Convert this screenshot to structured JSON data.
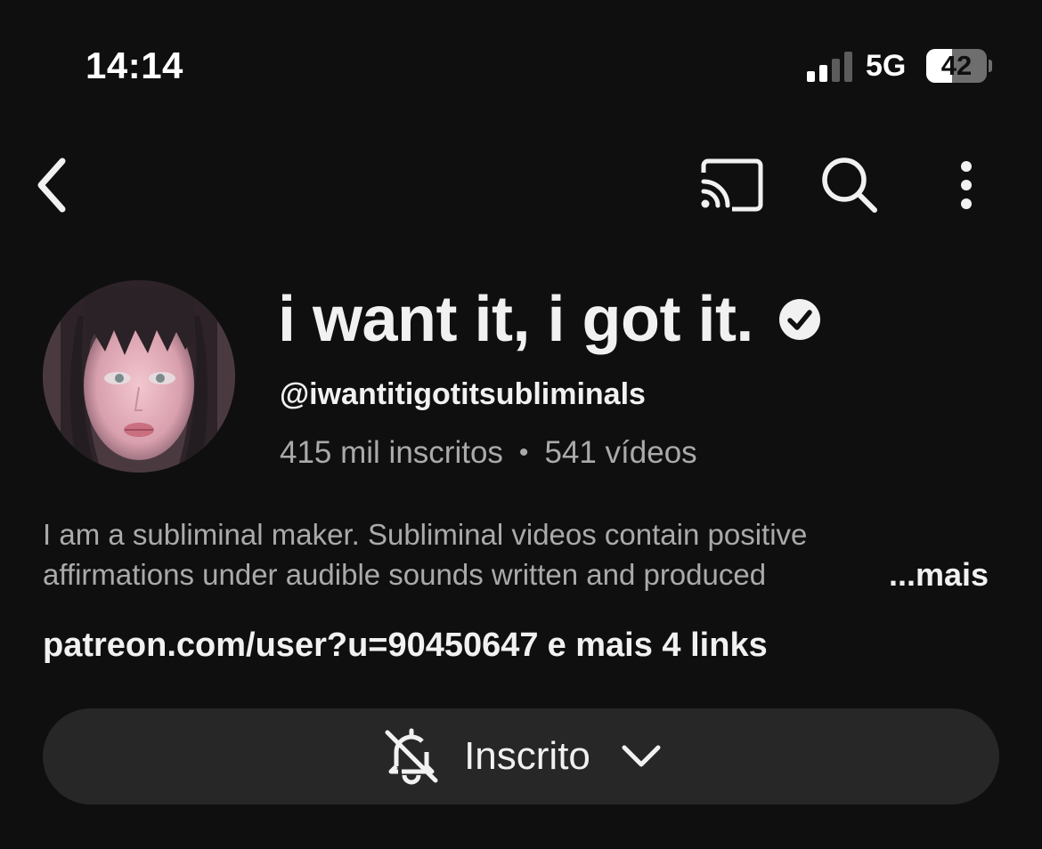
{
  "status_bar": {
    "time": "14:14",
    "network": "5G",
    "battery": "42",
    "signal_bars_active": 2,
    "signal_bars_total": 4
  },
  "top_bar": {
    "back_icon": "chevron-left-icon",
    "cast_icon": "cast-icon",
    "search_icon": "search-icon",
    "more_icon": "more-vertical-icon"
  },
  "channel": {
    "name": "i want it, i got it.",
    "verified": true,
    "handle": "@iwantitigotitsubliminals",
    "subscribers": "415 mil inscritos",
    "separator": "•",
    "videos": "541 vídeos",
    "description_line1": "I am a subliminal maker. Subliminal videos contain positive",
    "description_line2": "affirmations under audible sounds written and produced",
    "more_label": "...mais",
    "link_main": "patreon.com/user?u=90450647",
    "link_suffix": "e mais 4 links"
  },
  "subscribe_button": {
    "label": "Inscrito",
    "icon": "bell-off-icon",
    "chevron_icon": "chevron-down-icon"
  },
  "colors": {
    "background": "#0f0f0f",
    "primary_text": "#f1f1f1",
    "secondary_text": "#aaaaaa",
    "button_bg": "#272727"
  }
}
